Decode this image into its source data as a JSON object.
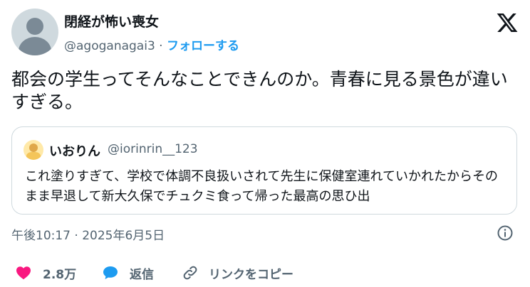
{
  "author": {
    "name": "閉経が怖い喪女",
    "handle": "@agoganagai3",
    "separator": "·",
    "follow_label": "フォローする"
  },
  "tweet": {
    "text": "都会の学生ってそんなことできんのか。青春に見る景色が違いすぎる。"
  },
  "quote": {
    "name": "いおりん",
    "handle": "@iorinrin__123",
    "text": "これ塗りすぎて、学校で体調不良扱いされて先生に保健室連れていかれたからそのまま早退して新大久保でチュクミ食って帰った最高の思ひ出"
  },
  "meta": {
    "timestamp": "午後10:17 · 2025年6月5日"
  },
  "actions": {
    "like_count": "2.8万",
    "reply_label": "返信",
    "copy_link_label": "リンクをコピー"
  },
  "icons": {
    "logo": "x-logo-icon",
    "info": "info-icon",
    "like": "heart-icon",
    "reply": "speech-bubble-icon",
    "copy": "link-icon"
  },
  "colors": {
    "accent": "#1d9bf0",
    "like": "#f91880",
    "secondary_text": "#536471",
    "border": "#cfd9de"
  }
}
